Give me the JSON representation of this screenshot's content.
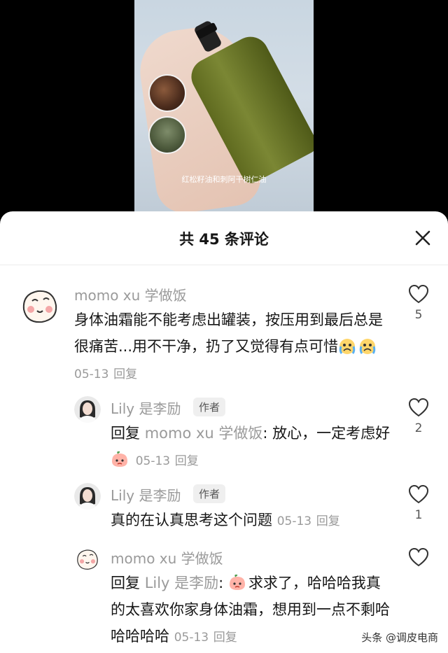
{
  "video": {
    "caption": "红松籽油和刺阿干树仁油"
  },
  "sheet": {
    "title": "共 45 条评论"
  },
  "comments": [
    {
      "user": "momo xu 学做饭",
      "text": "身体油霜能不能考虑出罐装，按压用到最后总是很痛苦...用不干净，扔了又觉得有点可惜",
      "date": "05-13",
      "reply_label": "回复",
      "likes": "5"
    },
    {
      "user": "Lily 是李励",
      "tag": "作者",
      "reply_prefix": "回复",
      "reply_to": "momo xu 学做饭",
      "text": ": 放心，一定考虑好",
      "date": "05-13",
      "reply_label": "回复",
      "likes": "2"
    },
    {
      "user": "Lily 是李励",
      "tag": "作者",
      "text": "真的在认真思考这个问题",
      "date": "05-13",
      "reply_label": "回复",
      "likes": "1"
    },
    {
      "user": "momo xu 学做饭",
      "reply_prefix": "回复",
      "reply_to": "Lily 是李励",
      "text_a": ": ",
      "text": "求求了，哈哈哈我真的太喜欢你家身体油霜，想用到一点不剩哈哈哈哈哈",
      "date": "05-13",
      "reply_label": "回复",
      "likes": ""
    }
  ],
  "watermark": "头条 @调皮电商"
}
